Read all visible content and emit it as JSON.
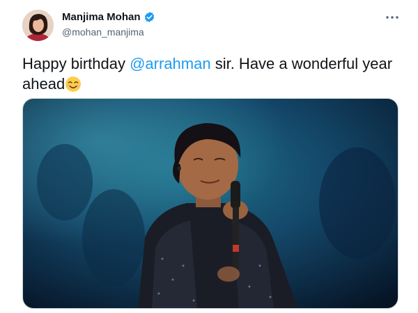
{
  "author": {
    "display_name": "Manjima Mohan",
    "handle": "@mohan_manjima",
    "verified": true
  },
  "tweet": {
    "text_before": "Happy birthday ",
    "mention": "@arrahman",
    "text_after": " sir. Have a wonderful year ahead",
    "emoji": "smiling-face-with-smiling-eyes"
  },
  "colors": {
    "accent": "#1d9bf0",
    "secondary_text": "#536471",
    "primary_text": "#0f1419"
  },
  "icons": {
    "more": "more-horizontal-icon",
    "verified": "verified-badge-icon"
  }
}
